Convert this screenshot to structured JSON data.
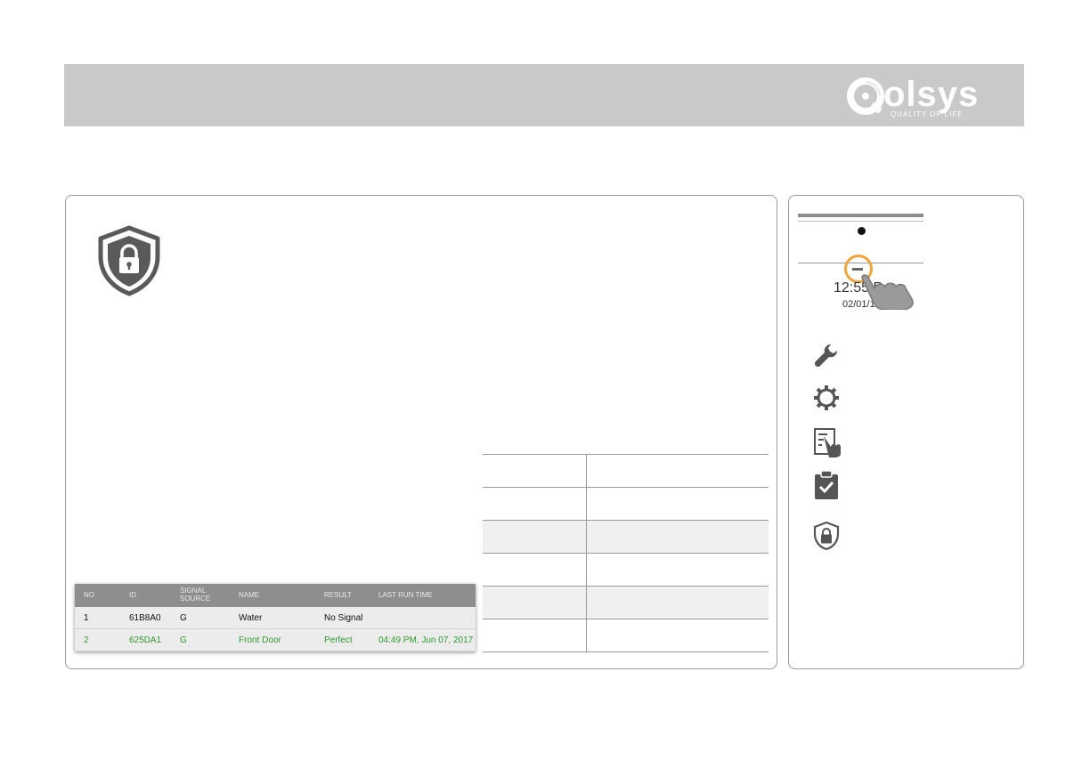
{
  "brand": {
    "name": "olsys",
    "tagline": "QUALITY OF LIFE"
  },
  "colors": {
    "banner": "#c9c9c9",
    "accent_ring": "#f0a53a",
    "success_green": "#2f9a2f",
    "icon_gray": "#555555"
  },
  "main": {
    "feature_icon": "shield-lock-icon",
    "test_table": {
      "headers": {
        "no": "NO",
        "id": "ID",
        "signal_line1": "SIGNAL",
        "signal_line2": "SOURCE",
        "name": "NAME",
        "result": "RESULT",
        "last": "LAST RUN TIME"
      },
      "rows": [
        {
          "no": "1",
          "id": "61B8A0",
          "signal": "G",
          "name": "Water",
          "result": "No Signal",
          "last": ""
        },
        {
          "no": "2",
          "id": "625DA1",
          "signal": "G",
          "name": "Front Door",
          "result": "Perfect",
          "last": "04:49 PM, Jun 07, 2017"
        }
      ]
    }
  },
  "side": {
    "mini_screen": {
      "time": "12:55 P",
      "date": "02/01/16"
    },
    "icons": [
      "wrench-icon",
      "gear-icon",
      "touch-panel-icon",
      "clipboard-check-icon",
      "shield-lock-icon"
    ]
  }
}
